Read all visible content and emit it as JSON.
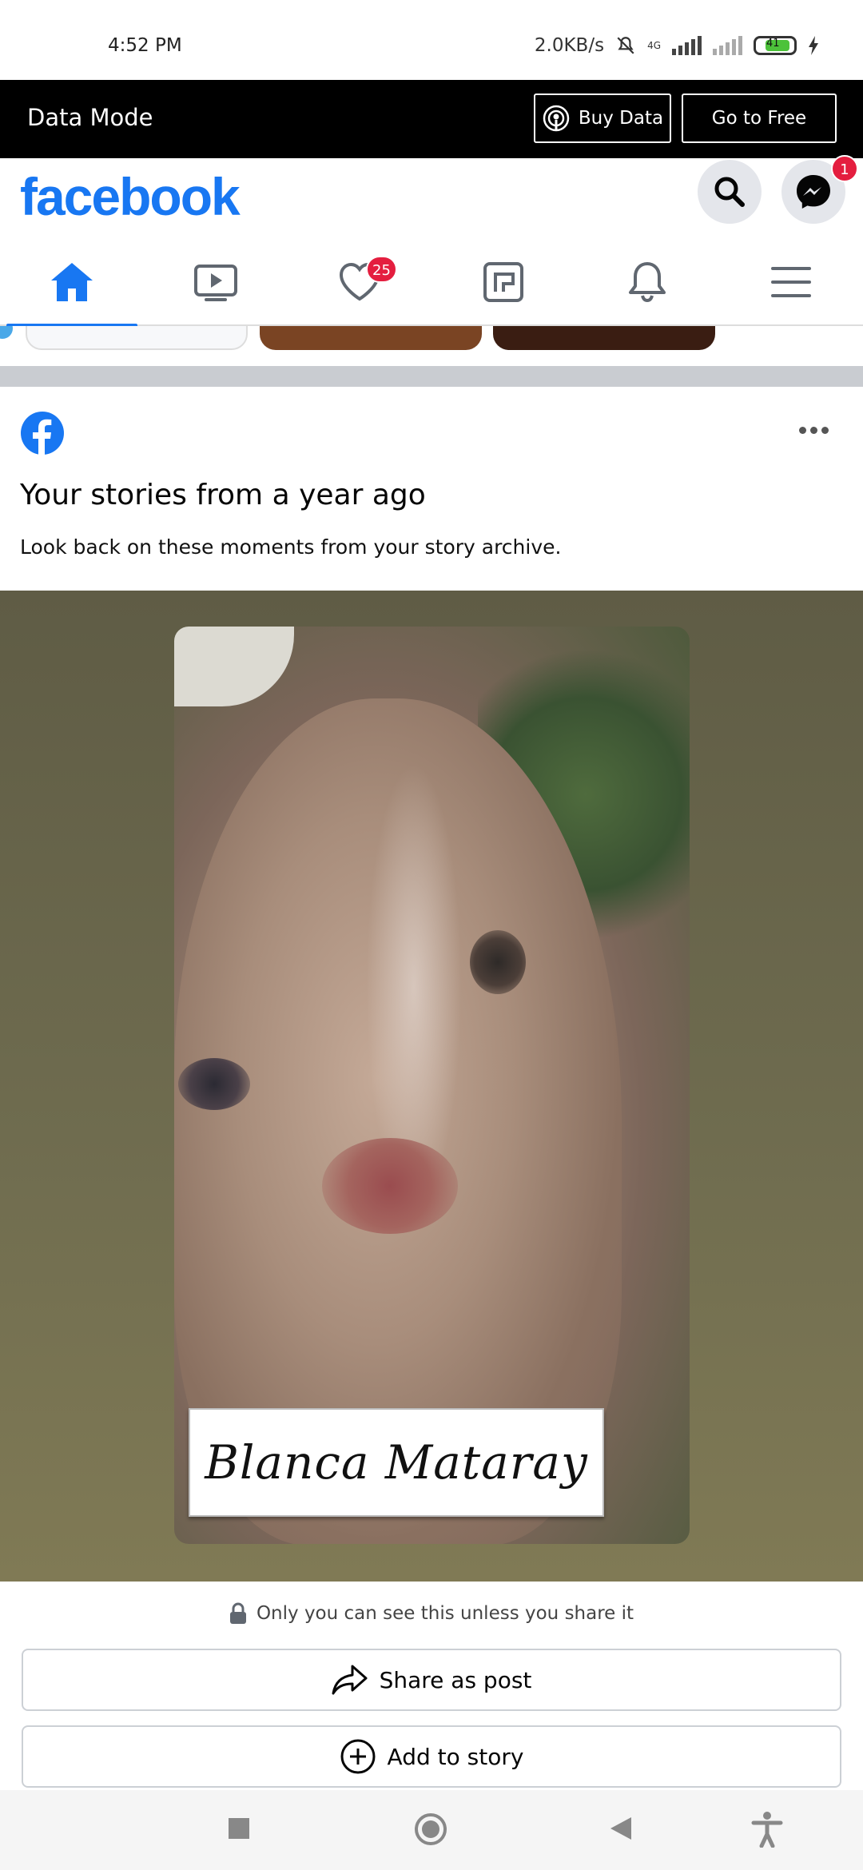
{
  "status_bar": {
    "time": "4:52 PM",
    "net_speed": "2.0KB/s",
    "network_type": "4G",
    "battery_level": "41"
  },
  "data_mode": {
    "title": "Data Mode",
    "buy_data_label": "Buy Data",
    "go_free_label": "Go to Free"
  },
  "header": {
    "logo": "facebook",
    "messenger_badge": "1"
  },
  "tabs": [
    {
      "name": "home",
      "icon": "home-icon",
      "active": true
    },
    {
      "name": "watch",
      "icon": "video-icon"
    },
    {
      "name": "dating",
      "icon": "heart-icon",
      "badge": "25"
    },
    {
      "name": "gaming",
      "icon": "gaming-icon"
    },
    {
      "name": "notifications",
      "icon": "bell-icon"
    },
    {
      "name": "menu",
      "icon": "hamburger-icon"
    }
  ],
  "post": {
    "title": "Your stories from a year ago",
    "subtitle": "Look back on these moments from your story archive.",
    "story_name_tag": "Blanca Mataray",
    "privacy_note": "Only you can see this unless you share it",
    "share_label": "Share as post",
    "add_story_label": "Add to story"
  },
  "colors": {
    "brand": "#1877f2",
    "badge": "#e41e3f",
    "data_bar": "#000000"
  }
}
